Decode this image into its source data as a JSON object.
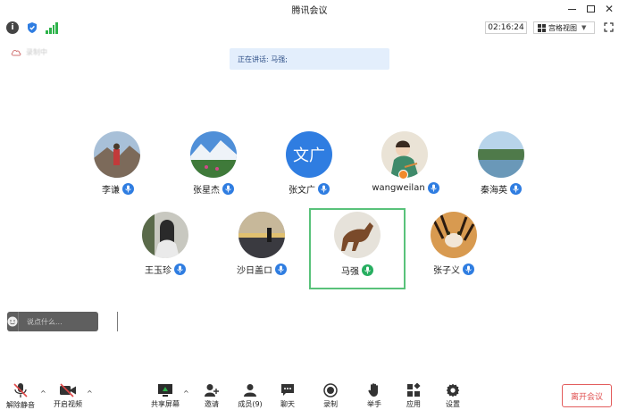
{
  "window": {
    "title": "腾讯会议"
  },
  "status": {
    "timer": "02:16:24",
    "view_mode": "宫格视图"
  },
  "cloud": {
    "text": "录制中"
  },
  "speaking": {
    "text": "正在讲话: 马强;"
  },
  "participants": [
    {
      "name": "李谦",
      "speaking": false
    },
    {
      "name": "张星杰",
      "speaking": false
    },
    {
      "name": "张文广",
      "avatar_text": "文广",
      "speaking": false
    },
    {
      "name": "wangweilan",
      "speaking": false
    },
    {
      "name": "秦海英",
      "speaking": false
    },
    {
      "name": "王玉珍",
      "speaking": false
    },
    {
      "name": "沙日盖ロ",
      "speaking": false
    },
    {
      "name": "马强",
      "speaking": true
    },
    {
      "name": "张子义",
      "speaking": false
    }
  ],
  "chat": {
    "placeholder": "说点什么..."
  },
  "toolbar": {
    "unmute": "解除静音",
    "start_video": "开启视频",
    "share_screen": "共享屏幕",
    "invite": "邀请",
    "members": "成员(9)",
    "chat": "聊天",
    "record": "录制",
    "raise_hand": "举手",
    "apps": "应用",
    "settings": "设置",
    "leave": "离开会议"
  },
  "colors": {
    "accent_blue": "#2f7de1",
    "speaking_green": "#27ae60",
    "active_border": "#59c27a",
    "leave_red": "#e05050",
    "banner_bg": "#e3eefc"
  }
}
